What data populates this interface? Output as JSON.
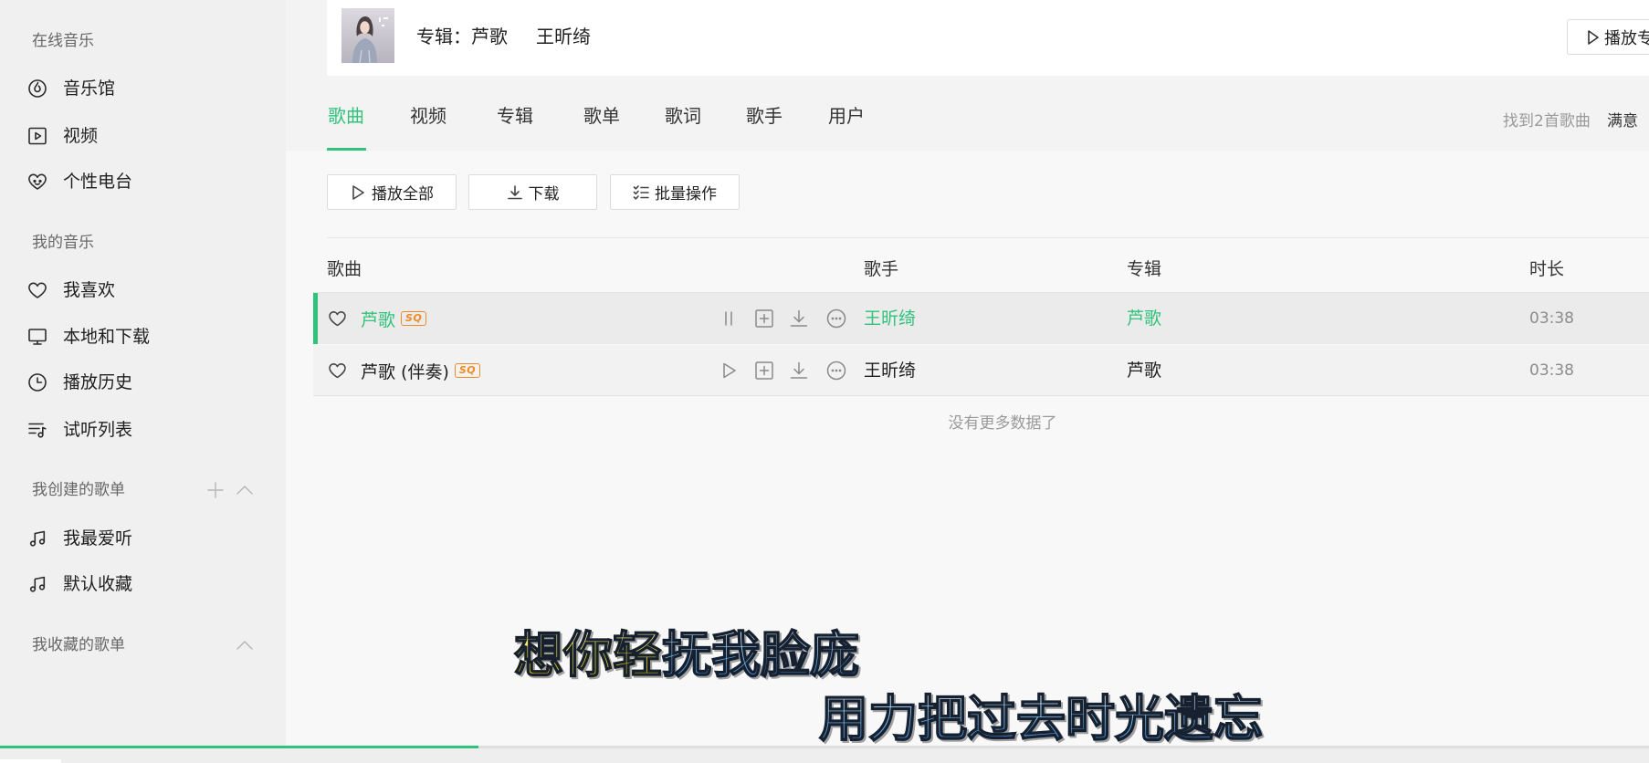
{
  "theme": {
    "accent": "#31c27c",
    "badge_color": "#f08a24"
  },
  "sidebar": {
    "online": {
      "title": "在线音乐",
      "items": [
        {
          "label": "音乐馆",
          "icon": "music-hall-icon"
        },
        {
          "label": "视频",
          "icon": "video-icon"
        },
        {
          "label": "个性电台",
          "icon": "radio-icon"
        }
      ]
    },
    "mine": {
      "title": "我的音乐",
      "items": [
        {
          "label": "我喜欢",
          "icon": "heart-icon"
        },
        {
          "label": "本地和下载",
          "icon": "monitor-icon"
        },
        {
          "label": "播放历史",
          "icon": "clock-icon"
        },
        {
          "label": "试听列表",
          "icon": "playlist-icon"
        }
      ]
    },
    "created": {
      "title": "我创建的歌单",
      "items": [
        {
          "label": "我最爱听",
          "icon": "music-note-icon"
        },
        {
          "label": "默认收藏",
          "icon": "music-note-icon"
        }
      ]
    },
    "collected": {
      "title": "我收藏的歌单"
    }
  },
  "header": {
    "album": "专辑：芦歌",
    "singer": "王昕绮",
    "play_button": "播放专"
  },
  "tabs": [
    {
      "label": "歌曲",
      "active": true
    },
    {
      "label": "视频",
      "active": false
    },
    {
      "label": "专辑",
      "active": false
    },
    {
      "label": "歌单",
      "active": false
    },
    {
      "label": "歌词",
      "active": false
    },
    {
      "label": "歌手",
      "active": false
    },
    {
      "label": "用户",
      "active": false
    }
  ],
  "results": {
    "found": "找到2首歌曲",
    "feedback": "满意"
  },
  "toolbar": {
    "play_all": "播放全部",
    "download": "下载",
    "batch": "批量操作"
  },
  "table": {
    "columns": {
      "song": "歌曲",
      "singer": "歌手",
      "album": "专辑",
      "duration": "时长"
    },
    "rows": [
      {
        "title": "芦歌",
        "quality": "SQ",
        "singer": "王昕绮",
        "album": "芦歌",
        "duration": "03:38",
        "playing": true
      },
      {
        "title": "芦歌 (伴奏)",
        "quality": "SQ",
        "singer": "王昕绮",
        "album": "芦歌",
        "duration": "03:38",
        "playing": false
      }
    ],
    "footer": "没有更多数据了"
  },
  "lyrics": {
    "line1_sung": "想你轻",
    "line1_unsung": "抚我脸庞",
    "line2": "用力把过去时光遗忘"
  },
  "player": {
    "progress": 0.29
  }
}
